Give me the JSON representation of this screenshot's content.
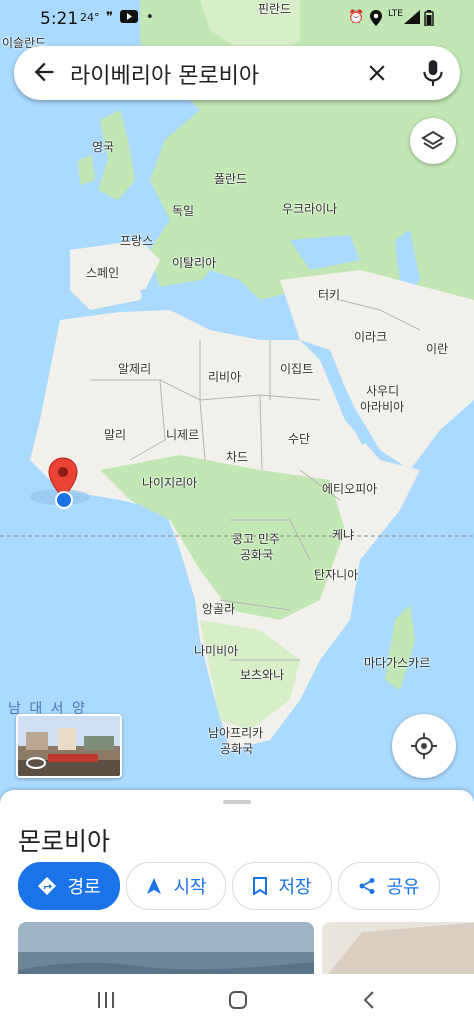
{
  "status_bar": {
    "time": "5:21",
    "temp": "24°",
    "network": "LTE"
  },
  "search": {
    "query": "라이베리아 몬로비아"
  },
  "map_labels": {
    "iceland": "이슬란드",
    "finland": "핀란드",
    "uk": "영국",
    "poland": "폴란드",
    "germany": "독일",
    "ukraine": "우크라이나",
    "france": "프랑스",
    "spain": "스페인",
    "italy": "이탈리아",
    "turkey": "터키",
    "iraq": "이라크",
    "iran": "이란",
    "algeria": "알제리",
    "libya": "리비아",
    "egypt": "이집트",
    "saudi_1": "사우디",
    "saudi_2": "아라비아",
    "mali": "말리",
    "niger": "니제르",
    "chad": "차드",
    "sudan": "수단",
    "nigeria": "나이지리아",
    "ethiopia": "에티오피아",
    "kenya": "케냐",
    "drc_1": "콩고 민주",
    "drc_2": "공화국",
    "tanzania": "탄자니아",
    "angola": "앙골라",
    "namibia": "나미비아",
    "botswana": "보츠와나",
    "madagascar": "마다가스카르",
    "south_africa_1": "남아프리카",
    "south_africa_2": "공화국",
    "atlantic": "남 대 서 양"
  },
  "place": {
    "name": "몬로비아"
  },
  "actions": {
    "directions": "경로",
    "start": "시작",
    "save": "저장",
    "share": "공유"
  },
  "colors": {
    "accent": "#1a73e8",
    "land": "#f1f0ea",
    "water": "#aadaff",
    "forest": "#c2e7b5",
    "pin": "#ea4335"
  }
}
